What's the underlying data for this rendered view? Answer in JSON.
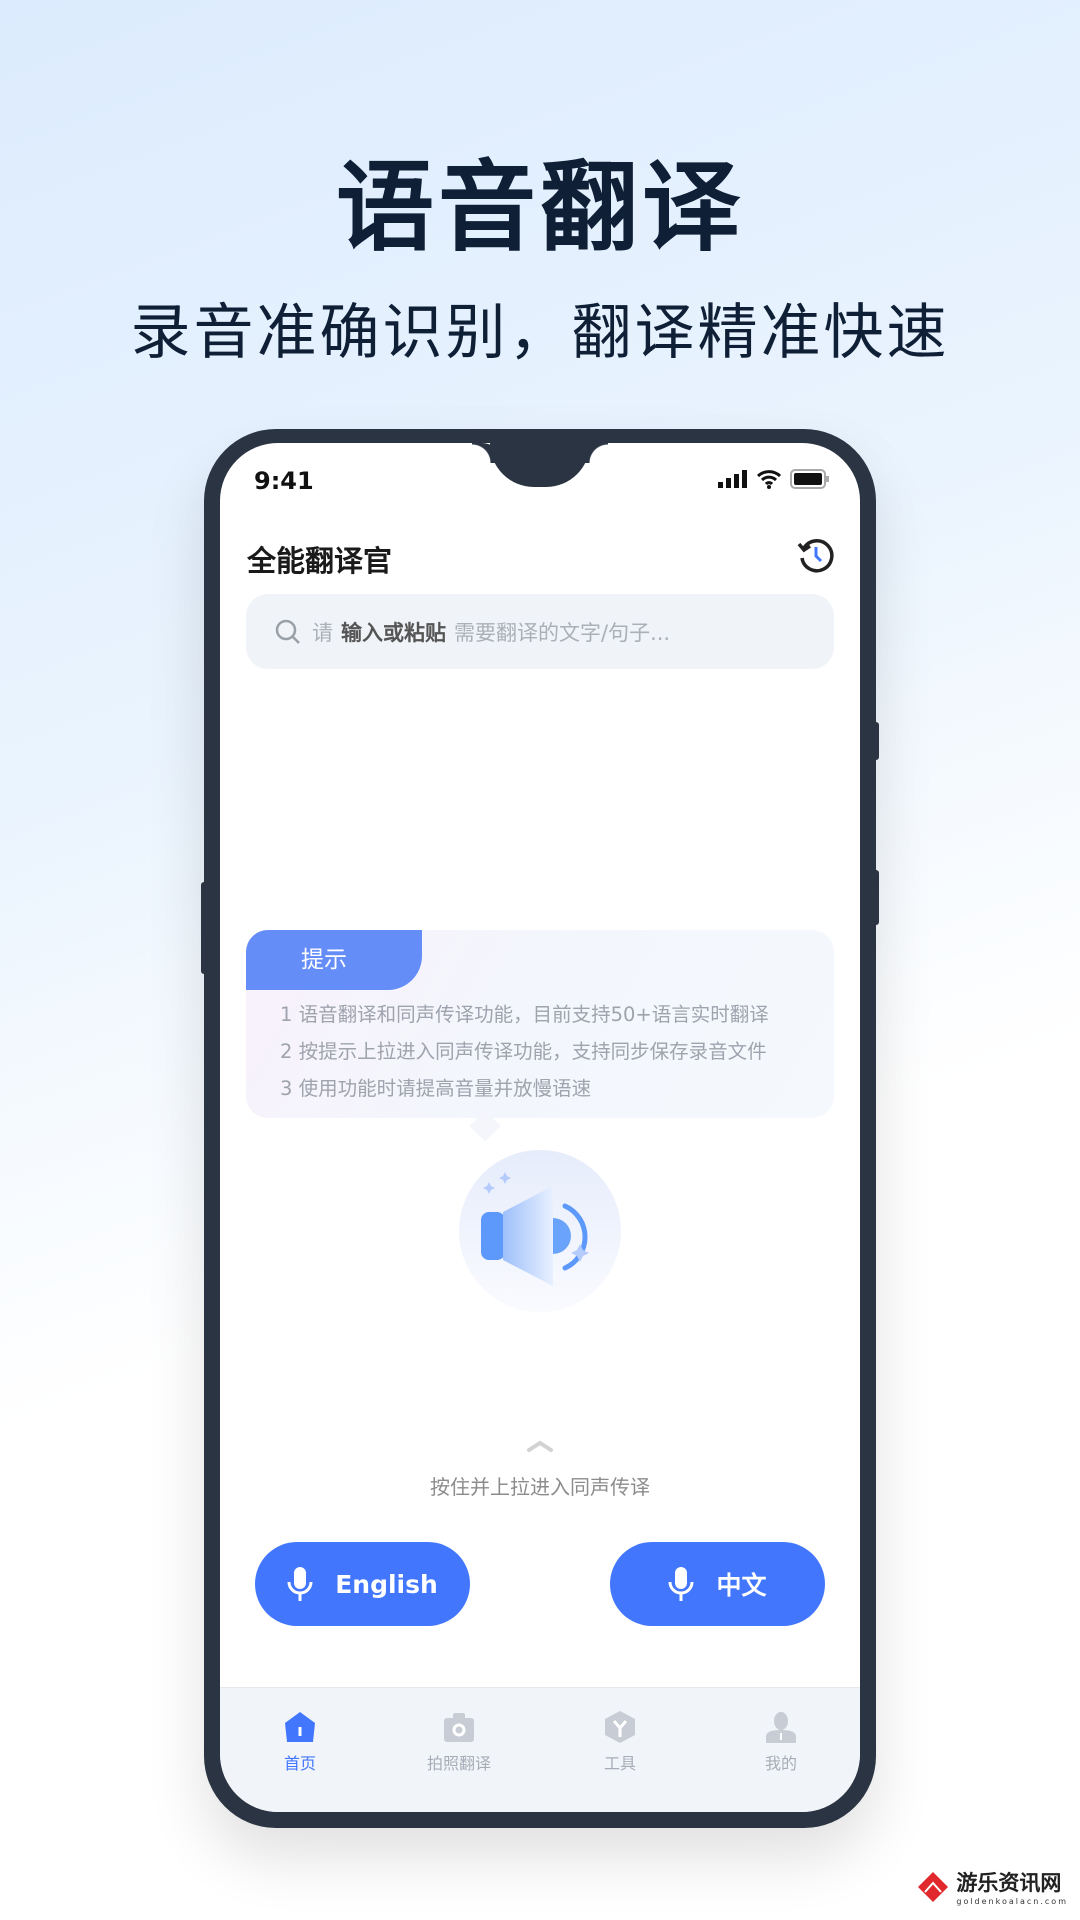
{
  "promo": {
    "headline": "语音翻译",
    "subline": "录音准确识别，翻译精准快速"
  },
  "status_bar": {
    "time": "9:41",
    "icons": [
      "signal-icon",
      "wifi-icon",
      "battery-icon"
    ]
  },
  "app": {
    "title": "全能翻译官",
    "history_icon": "history-clock-icon"
  },
  "search": {
    "prefix": "请",
    "emphasis": "输入或粘贴",
    "placeholder": "需要翻译的文字/句子..."
  },
  "tip": {
    "label": "提示",
    "lines": [
      "1 语音翻译和同声传译功能，目前支持50+语言实时翻译",
      "2 按提示上拉进入同声传译功能，支持同步保存录音文件",
      "3 使用功能时请提高音量并放慢语速"
    ]
  },
  "hint": "按住并上拉进入同声传译",
  "languages": {
    "left": "English",
    "right": "中文"
  },
  "tabs": [
    {
      "label": "首页",
      "active": true
    },
    {
      "label": "拍照翻译"
    },
    {
      "label": "工具"
    },
    {
      "label": "我的"
    }
  ],
  "colors": {
    "accent": "#4277fd",
    "tab_inactive": "#a7adb8",
    "title": "#0f1f36"
  },
  "watermark": {
    "name": "游乐资讯网",
    "domain": "goldenkoalacn.com"
  }
}
